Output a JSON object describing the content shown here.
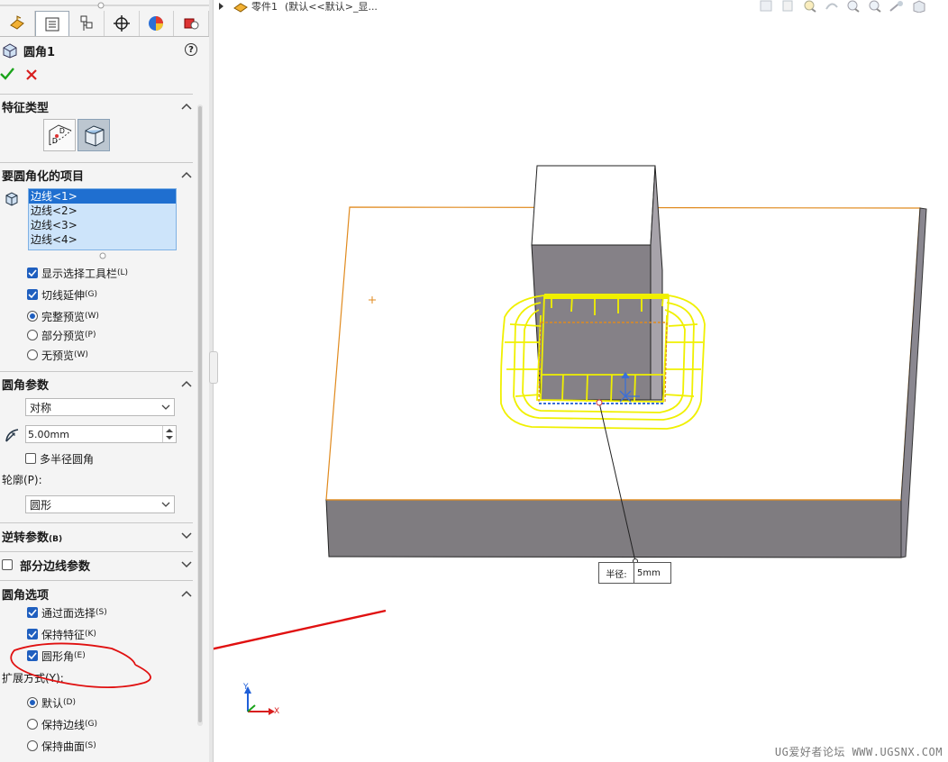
{
  "feature": {
    "title": "圆角1",
    "help": "?"
  },
  "breadcrumb": {
    "part": "零件1",
    "config": "(默认<<默认>_显..."
  },
  "sections": {
    "feature_type": {
      "title": "特征类型"
    },
    "items": {
      "title": "要圆角化的项目",
      "edges": [
        "边线<1>",
        "边线<2>",
        "边线<3>",
        "边线<4>"
      ],
      "show_toolbar": "显示选择工具栏",
      "show_toolbar_key": "(L)",
      "tangent": "切线延伸",
      "tangent_key": "(G)",
      "full_preview": "完整预览",
      "full_preview_key": "(W)",
      "partial_preview": "部分预览",
      "partial_preview_key": "(P)",
      "no_preview": "无预览",
      "no_preview_key": "(W)"
    },
    "params": {
      "title": "圆角参数",
      "method": "对称",
      "radius": "5.00mm",
      "multi_radius": "多半径圆角",
      "profile_label": "轮廓(P):",
      "profile": "圆形"
    },
    "setback": {
      "title": "逆转参数",
      "key": "(B)"
    },
    "partial": {
      "title": "部分边线参数"
    },
    "options": {
      "title": "圆角选项",
      "select_through": "通过面选择",
      "select_through_key": "(S)",
      "keep_features": "保持特征",
      "keep_features_key": "(K)",
      "round_corners": "圆形角",
      "round_corners_key": "(E)",
      "overflow_label": "扩展方式(Y):",
      "default": "默认",
      "default_key": "(D)",
      "keep_edge": "保持边线",
      "keep_edge_key": "(G)",
      "keep_surface": "保持曲面",
      "keep_surface_key": "(S)"
    }
  },
  "callout": {
    "label": "半径:",
    "value": "5mm"
  },
  "triad": {
    "y": "Y",
    "x": "X"
  },
  "watermark": "UG爱好者论坛 WWW.UGSNX.COM",
  "colors": {
    "accent": "#1f5fbf",
    "preview": "#f0f000",
    "edge": "#e08a1e",
    "annotation": "#e01010",
    "confirm": "#1aa31a",
    "cancel": "#d81e1e"
  }
}
